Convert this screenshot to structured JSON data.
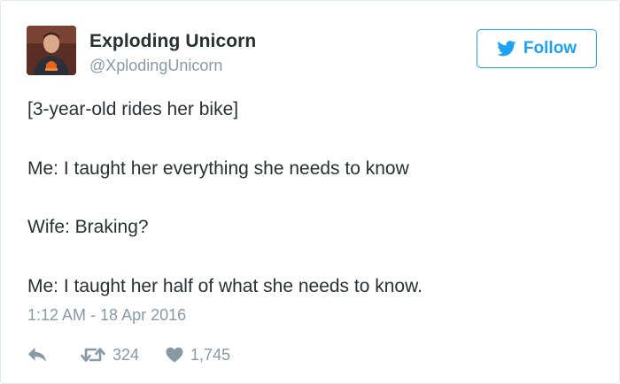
{
  "tweet": {
    "display_name": "Exploding Unicorn",
    "handle": "@XplodingUnicorn",
    "follow_label": "Follow",
    "lines": [
      "[3-year-old rides her bike]",
      "Me: I taught her everything she needs to know",
      "Wife: Braking?",
      "Me: I taught her half of what she needs to know."
    ],
    "timestamp": "1:12 AM - 18 Apr 2016",
    "retweet_count": "324",
    "like_count": "1,745"
  },
  "colors": {
    "accent": "#1da1f2",
    "muted": "#8899a6",
    "text": "#292f33",
    "border": "#e1e8ed"
  },
  "icons": {
    "follow": "twitter-bird-icon",
    "reply": "reply-arrow-icon",
    "retweet": "retweet-icon",
    "like": "heart-icon"
  }
}
